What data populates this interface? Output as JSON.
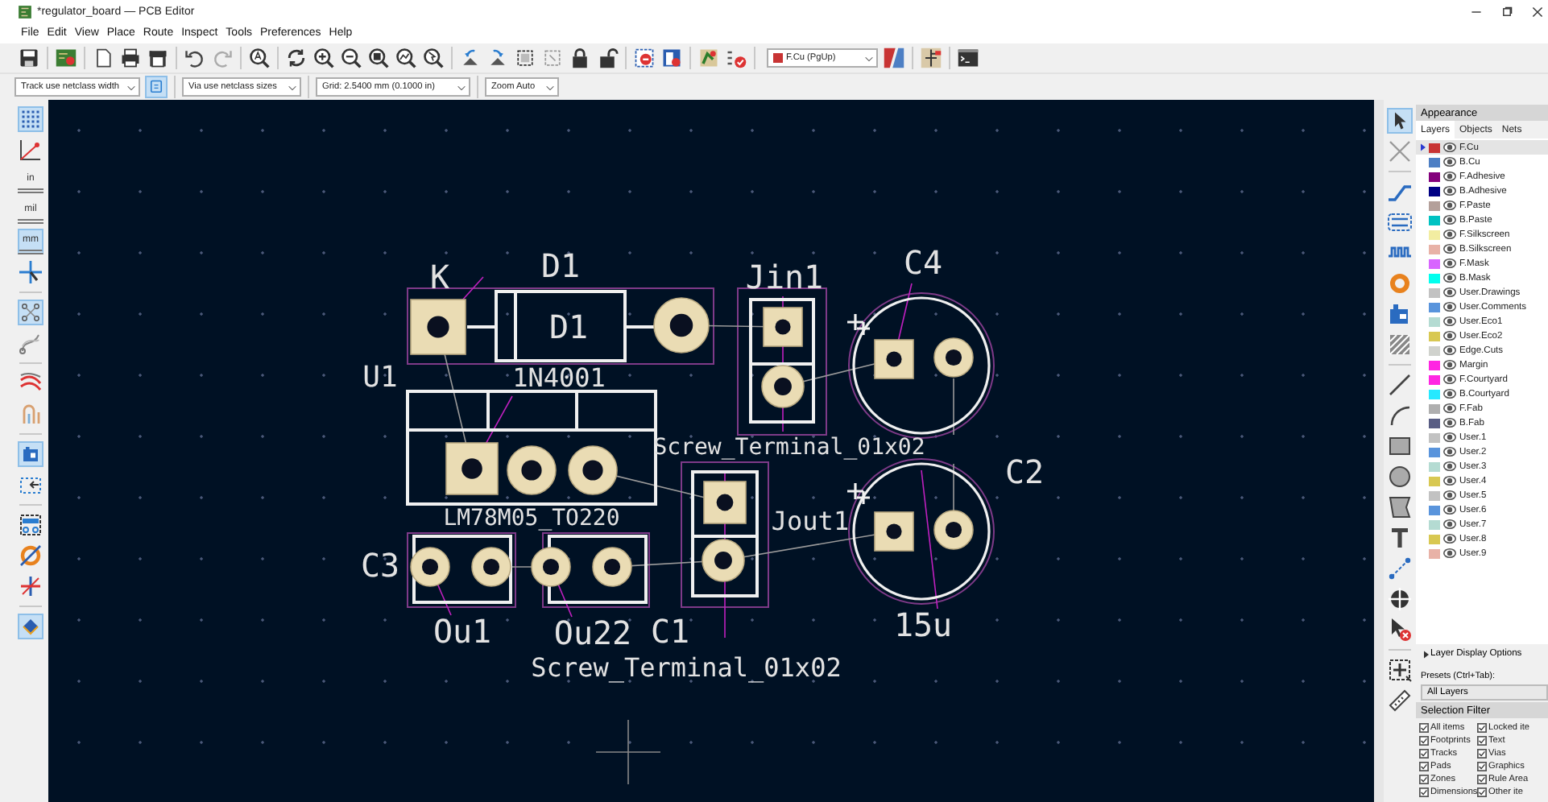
{
  "window": {
    "title": "*regulator_board — PCB Editor"
  },
  "menu": [
    "File",
    "Edit",
    "View",
    "Place",
    "Route",
    "Inspect",
    "Tools",
    "Preferences",
    "Help"
  ],
  "toolbar": {
    "active_layer": {
      "label": "F.Cu (PgUp)",
      "color": "#c83434"
    }
  },
  "options_bar": {
    "track_width": "Track use netclass width",
    "track_mode": {
      "on": true
    },
    "via_size": "Via use netclass sizes",
    "grid": "Grid: 2.5400 mm (0.1000 in)",
    "zoom": "Zoom Auto"
  },
  "left_toolbar": [
    [
      {
        "on": true
      },
      {
        "on": false
      },
      {
        "label": "in",
        "on": false
      },
      {
        "label": "mil",
        "on": false
      },
      {
        "label": "mm",
        "on": true
      },
      {
        "on": false
      }
    ],
    [
      {
        "on": true
      },
      {
        "on": false
      }
    ],
    [
      {
        "on": false
      },
      {
        "on": false
      }
    ],
    [
      {
        "on": true
      },
      {
        "on": false
      }
    ],
    [
      {
        "on": false
      },
      {
        "on": false
      },
      {
        "on": false
      }
    ],
    [
      {
        "on": true
      }
    ]
  ],
  "canvas": {
    "labels": [
      "K",
      "D1",
      "D1",
      "U1",
      "1N4001",
      "Jin1",
      "C4",
      "Screw_Terminal_01x02",
      "Jout1",
      "C2",
      "C3",
      "C1",
      "LM78M05_TO220",
      "Screw_Terminal_01x02",
      "Ou1",
      "Ou22",
      "15u"
    ]
  },
  "right_toolbar": [
    [
      {
        "on": true
      },
      {
        "on": false
      }
    ],
    [
      {
        "on": false
      },
      {
        "on": false
      },
      {
        "on": false
      },
      {
        "on": false
      },
      {
        "on": false
      },
      {
        "on": false
      }
    ],
    [
      {
        "on": false
      },
      {
        "on": false
      },
      {
        "on": false
      },
      {
        "on": false
      },
      {
        "on": false
      },
      {
        "on": false
      },
      {
        "on": false
      },
      {
        "on": false
      },
      {
        "on": false
      }
    ],
    [
      {
        "on": false
      },
      {
        "on": false
      }
    ]
  ],
  "appearance": {
    "title": "Appearance",
    "tabs": [
      {
        "label": "Layers",
        "selected": true
      },
      {
        "label": "Objects",
        "selected": false
      },
      {
        "label": "Nets",
        "selected": false
      }
    ],
    "layers": [
      {
        "name": "F.Cu",
        "color": "#c83434",
        "visible": true,
        "selected": true
      },
      {
        "name": "B.Cu",
        "color": "#4d7fc4",
        "visible": true,
        "selected": false
      },
      {
        "name": "F.Adhesive",
        "color": "#84007c",
        "visible": true,
        "selected": false
      },
      {
        "name": "B.Adhesive",
        "color": "#000084",
        "visible": true,
        "selected": false
      },
      {
        "name": "F.Paste",
        "color": "#b4a09a",
        "visible": true,
        "selected": false
      },
      {
        "name": "B.Paste",
        "color": "#00c2c2",
        "visible": true,
        "selected": false
      },
      {
        "name": "F.Silkscreen",
        "color": "#f2eda1",
        "visible": true,
        "selected": false
      },
      {
        "name": "B.Silkscreen",
        "color": "#e8b2a7",
        "visible": true,
        "selected": false
      },
      {
        "name": "F.Mask",
        "color": "#d864ff",
        "visible": true,
        "selected": false
      },
      {
        "name": "B.Mask",
        "color": "#02ffee",
        "visible": true,
        "selected": false
      },
      {
        "name": "User.Drawings",
        "color": "#c2c2c2",
        "visible": true,
        "selected": false
      },
      {
        "name": "User.Comments",
        "color": "#5994dc",
        "visible": true,
        "selected": false
      },
      {
        "name": "User.Eco1",
        "color": "#b4dbd2",
        "visible": true,
        "selected": false
      },
      {
        "name": "User.Eco2",
        "color": "#d8c852",
        "visible": true,
        "selected": false
      },
      {
        "name": "Edge.Cuts",
        "color": "#d0d2cd",
        "visible": true,
        "selected": false
      },
      {
        "name": "Margin",
        "color": "#ff26e2",
        "visible": true,
        "selected": false
      },
      {
        "name": "F.Courtyard",
        "color": "#ff26e2",
        "visible": true,
        "selected": false
      },
      {
        "name": "B.Courtyard",
        "color": "#26e9ff",
        "visible": true,
        "selected": false
      },
      {
        "name": "F.Fab",
        "color": "#afafaf",
        "visible": true,
        "selected": false
      },
      {
        "name": "B.Fab",
        "color": "#585d84",
        "visible": true,
        "selected": false
      },
      {
        "name": "User.1",
        "color": "#c2c2c2",
        "visible": true,
        "selected": false
      },
      {
        "name": "User.2",
        "color": "#5994dc",
        "visible": true,
        "selected": false
      },
      {
        "name": "User.3",
        "color": "#b4dbd2",
        "visible": true,
        "selected": false
      },
      {
        "name": "User.4",
        "color": "#d8c852",
        "visible": true,
        "selected": false
      },
      {
        "name": "User.5",
        "color": "#c2c2c2",
        "visible": true,
        "selected": false
      },
      {
        "name": "User.6",
        "color": "#5994dc",
        "visible": true,
        "selected": false
      },
      {
        "name": "User.7",
        "color": "#b4dbd2",
        "visible": true,
        "selected": false
      },
      {
        "name": "User.8",
        "color": "#d8c852",
        "visible": true,
        "selected": false
      },
      {
        "name": "User.9",
        "color": "#e8b2a7",
        "visible": true,
        "selected": false
      }
    ],
    "display_options": "Layer Display Options",
    "presets_label": "Presets (Ctrl+Tab):",
    "preset": "All Layers",
    "selection_filter": {
      "title": "Selection Filter",
      "items": [
        {
          "label": "All items",
          "checked": true
        },
        {
          "label": "Locked ite",
          "checked": true
        },
        {
          "label": "Footprints",
          "checked": true
        },
        {
          "label": "Text",
          "checked": true
        },
        {
          "label": "Tracks",
          "checked": true
        },
        {
          "label": "Vias",
          "checked": true
        },
        {
          "label": "Pads",
          "checked": true
        },
        {
          "label": "Graphics",
          "checked": true
        },
        {
          "label": "Zones",
          "checked": true
        },
        {
          "label": "Rule Area",
          "checked": true
        },
        {
          "label": "Dimensions",
          "checked": true
        },
        {
          "label": "Other ite",
          "checked": true
        }
      ]
    }
  }
}
